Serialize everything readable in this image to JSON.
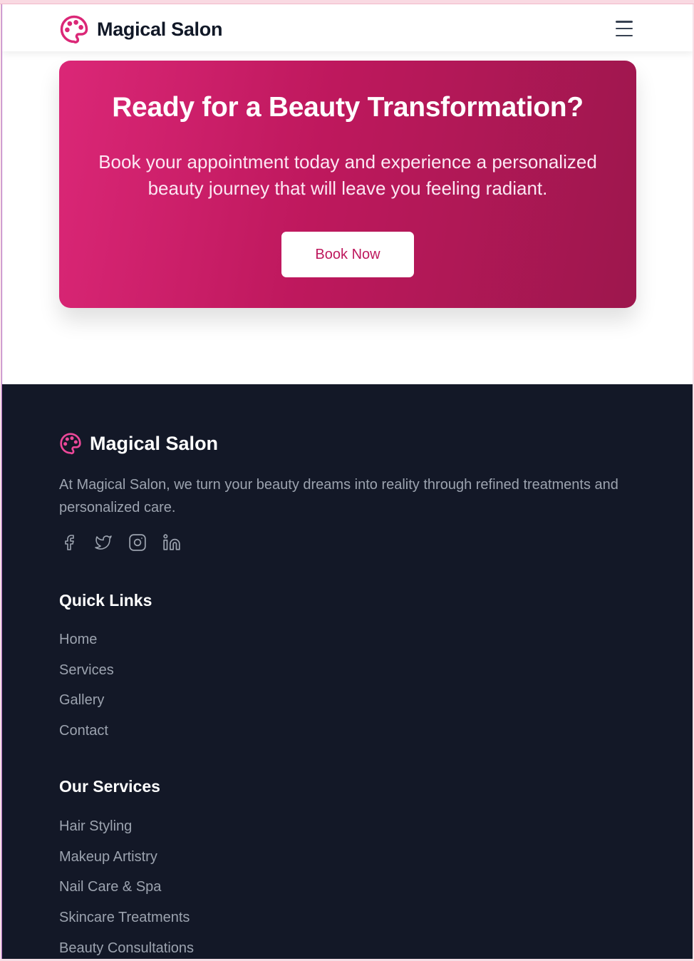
{
  "header": {
    "brand_name": "Magical Salon",
    "logo_icon": "palette-icon",
    "menu_icon": "hamburger-menu-icon"
  },
  "cta": {
    "title": "Ready for a Beauty Transformation?",
    "description": "Book your appointment today and experience a personalized beauty journey that will leave you feeling radiant.",
    "button_label": "Book Now"
  },
  "footer": {
    "brand_name": "Magical Salon",
    "logo_icon": "palette-icon",
    "description": "At Magical Salon, we turn your beauty dreams into reality through refined treatments and personalized care.",
    "socials": [
      "facebook-icon",
      "twitter-icon",
      "instagram-icon",
      "linkedin-icon"
    ],
    "quick_links": {
      "heading": "Quick Links",
      "items": [
        "Home",
        "Services",
        "Gallery",
        "Contact"
      ]
    },
    "services": {
      "heading": "Our Services",
      "items": [
        "Hair Styling",
        "Makeup Artistry",
        "Nail Care & Spa",
        "Skincare Treatments",
        "Beauty Consultations"
      ]
    }
  },
  "colors": {
    "brand_pink": "#db2777",
    "cta_gradient_start": "#db2777",
    "cta_gradient_end": "#9d174d",
    "footer_bg": "#131827",
    "footer_text": "#9ca3af"
  }
}
